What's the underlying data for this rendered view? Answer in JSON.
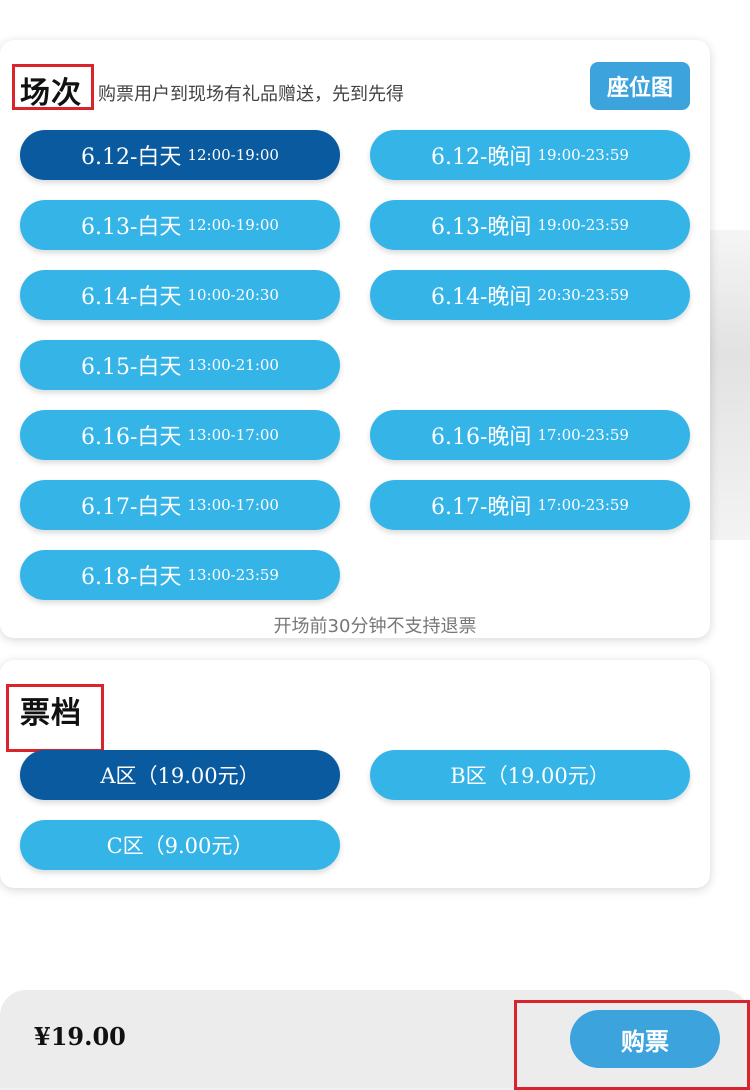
{
  "sessions_section": {
    "title": "场次",
    "hint": "购票用户到现场有礼品赠送，先到先得",
    "seat_map_label": "座位图",
    "note": "开场前30分钟不支持退票",
    "sessions": [
      {
        "label": "6.12-白天",
        "time": "12:00-19:00",
        "selected": true
      },
      {
        "label": "6.12-晚间",
        "time": "19:00-23:59",
        "selected": false
      },
      {
        "label": "6.13-白天",
        "time": "12:00-19:00",
        "selected": false
      },
      {
        "label": "6.13-晚间",
        "time": "19:00-23:59",
        "selected": false
      },
      {
        "label": "6.14-白天",
        "time": "10:00-20:30",
        "selected": false
      },
      {
        "label": "6.14-晚间",
        "time": "20:30-23:59",
        "selected": false
      },
      {
        "label": "6.15-白天",
        "time": "13:00-21:00",
        "selected": false
      },
      {
        "label": "6.16-白天",
        "time": "13:00-17:00",
        "selected": false
      },
      {
        "label": "6.16-晚间",
        "time": "17:00-23:59",
        "selected": false
      },
      {
        "label": "6.17-白天",
        "time": "13:00-17:00",
        "selected": false
      },
      {
        "label": "6.17-晚间",
        "time": "17:00-23:59",
        "selected": false
      },
      {
        "label": "6.18-白天",
        "time": "13:00-23:59",
        "selected": false
      }
    ]
  },
  "tickets_section": {
    "title": "票档",
    "tiers": [
      {
        "label": "A区（19.00元）",
        "selected": true
      },
      {
        "label": "B区（19.00元）",
        "selected": false
      },
      {
        "label": "C区（9.00元）",
        "selected": false
      }
    ]
  },
  "bottom_bar": {
    "price": "¥19.00",
    "buy_label": "购票"
  },
  "colors": {
    "pill": "#35b4e8",
    "pill_selected": "#0a5aa0",
    "button": "#3da3dd",
    "highlight_box": "#d9242b"
  }
}
